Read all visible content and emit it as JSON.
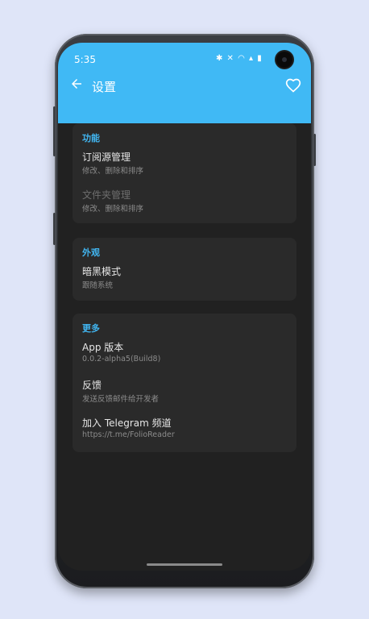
{
  "status_bar": {
    "time": "5:35",
    "icons": "✱ ✕ ◠ ▴ ▮"
  },
  "app_bar": {
    "title": "设置"
  },
  "sections": [
    {
      "header": "功能",
      "items": [
        {
          "title": "订阅源管理",
          "subtitle": "修改、删除和排序",
          "enabled": true
        },
        {
          "title": "文件夹管理",
          "subtitle": "修改、删除和排序",
          "enabled": false
        }
      ]
    },
    {
      "header": "外观",
      "items": [
        {
          "title": "暗黑模式",
          "subtitle": "跟随系统",
          "enabled": true
        }
      ]
    },
    {
      "header": "更多",
      "items": [
        {
          "title": "App 版本",
          "subtitle": "0.0.2-alpha5(Build8)",
          "enabled": true
        },
        {
          "title": "反馈",
          "subtitle": "发送反馈邮件给开发者",
          "enabled": true
        },
        {
          "title": "加入 Telegram 频道",
          "subtitle": "https://t.me/FolioReader",
          "enabled": true
        }
      ]
    }
  ],
  "colors": {
    "accent": "#40b9f5",
    "background": "#dfe5f8",
    "card": "#2a2a2a",
    "screen": "#212121"
  },
  "icons": {
    "back": "arrow-back-icon",
    "favorite": "heart-outline-icon"
  }
}
